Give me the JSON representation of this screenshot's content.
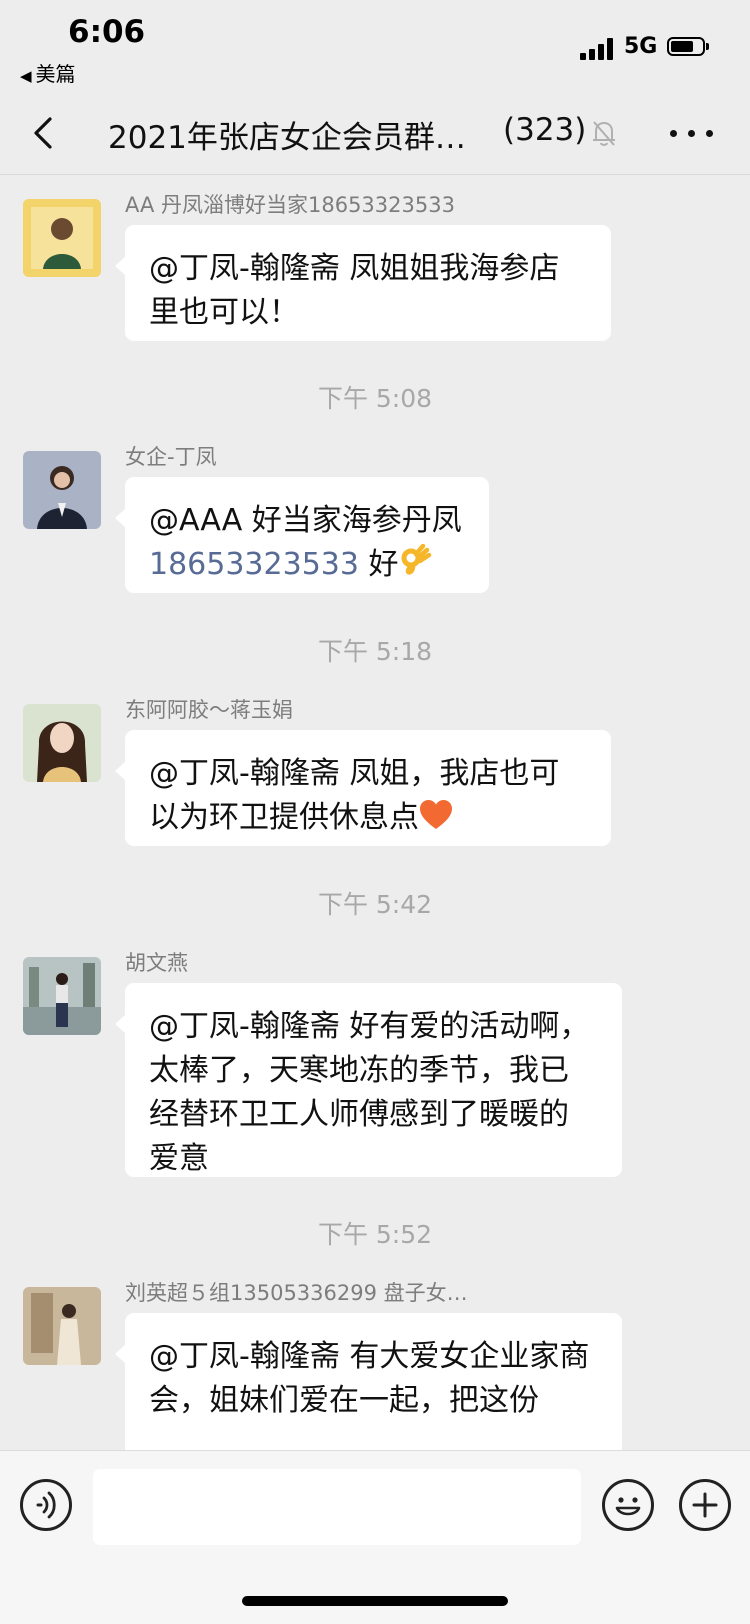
{
  "status_bar": {
    "time": "6:06",
    "back_app": "美篇",
    "network": "5G"
  },
  "header": {
    "title": "2021年张店女企会员群…",
    "member_count": "(323)"
  },
  "messages": [
    {
      "type": "message",
      "sender": "AA 丹凤淄博好当家18653323533",
      "text": "@丁凤-翰隆斋 凤姐姐我海参店里也可以！",
      "avatar_color": "#e8c34a"
    },
    {
      "type": "time",
      "text": "下午 5:08"
    },
    {
      "type": "message",
      "sender": "女企-丁凤",
      "text_prefix": "@AAA 好当家海参丹凤 ",
      "phone": "18653323533",
      "text_suffix": " 好",
      "emoji": "ok-hand-emoji",
      "avatar_color": "#9aa6bd"
    },
    {
      "type": "time",
      "text": "下午 5:18"
    },
    {
      "type": "message",
      "sender": "东阿阿胶～蒋玉娟",
      "text": "@丁凤-翰隆斋 凤姐，我店也可以为环卫提供休息点",
      "emoji": "orange-heart-emoji",
      "avatar_color": "#c8d6bf"
    },
    {
      "type": "time",
      "text": "下午 5:42"
    },
    {
      "type": "message",
      "sender": "胡文燕",
      "text": "@丁凤-翰隆斋 好有爱的活动啊，太棒了，天寒地冻的季节，我已经替环卫工人师傅感到了暖暖的爱意",
      "avatar_color": "#a9b4b0"
    },
    {
      "type": "time",
      "text": "下午 5:52"
    },
    {
      "type": "message",
      "sender": "刘英超５组13505336299 盘子女…",
      "text": "@丁凤-翰隆斋 有大爱女企业家商会，姐妹们爱在一起，把这份",
      "avatar_color": "#b8a58c"
    }
  ],
  "input": {
    "value": "",
    "placeholder": ""
  },
  "colors": {
    "background": "#ededed",
    "bubble": "#ffffff",
    "link": "#576b95",
    "secondary_text": "#7d7d7d"
  }
}
